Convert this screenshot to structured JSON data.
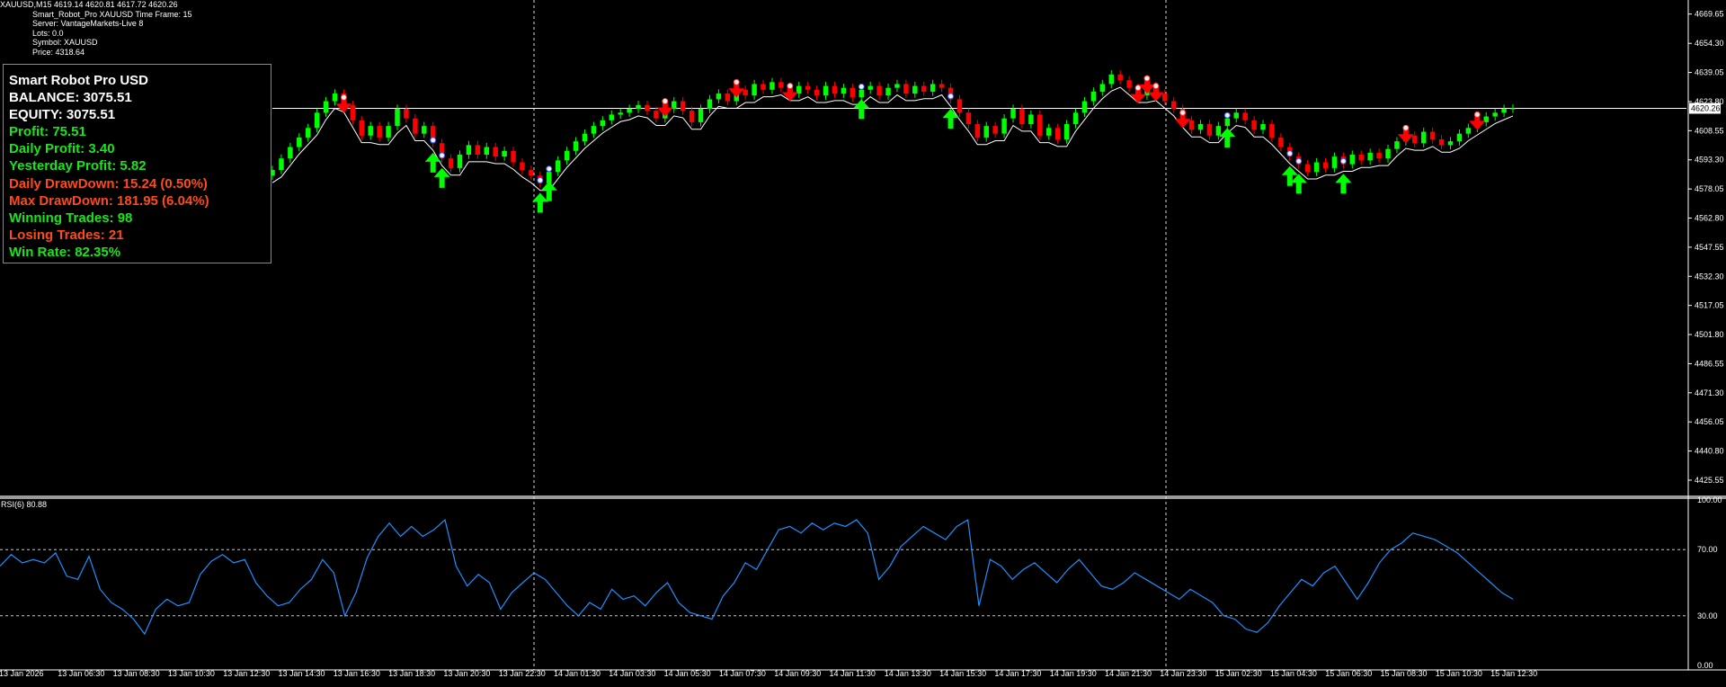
{
  "window": {
    "header_line": "XAUUSD,M15  4619.14 4620.81 4617.72 4620.26",
    "indicator_lines": [
      "Smart_Robot_Pro  XAUUSD   Time Frame: 15",
      "Server: VantageMarkets-Live 8",
      "Lots: 0.0",
      "Symbol: XAUUSD",
      "Price:  4318.64"
    ]
  },
  "panel": {
    "title": "Smart Robot Pro USD",
    "balance": "BALANCE: 3075.51",
    "equity": "EQUITY: 3075.51",
    "profit": "Profit: 75.51",
    "daily_profit": "Daily Profit: 3.40",
    "yesterday_profit": "Yesterday Profit: 5.82",
    "daily_drawdown": "Daily DrawDown: 15.24 (0.50%)",
    "max_drawdown": "Max DrawDown: 181.95 (6.04%)",
    "winning_trades": "Winning Trades: 98",
    "losing_trades": "Losing Trades: 21",
    "win_rate": "Win Rate: 82.35%"
  },
  "rsi": {
    "label": "RSI(6) 80.88"
  },
  "colors": {
    "background": "#000000",
    "bull": "#00ff00",
    "bear": "#ff0000",
    "rsi_line": "#1e90ff",
    "price_line": "#ffffff",
    "price_tag_bg": "#ffffff",
    "arrow_up": "#00ff00",
    "arrow_down": "#ff0000"
  },
  "chart_data": {
    "type": "candlestick",
    "symbol": "XAUUSD",
    "timeframe": "M15",
    "current_price": 4620.26,
    "price_ticks": [
      "4669.65",
      "4654.30",
      "4639.05",
      "4623.80",
      "4608.55",
      "4593.30",
      "4578.05",
      "4562.80",
      "4547.55",
      "4532.30",
      "4517.05",
      "4501.80",
      "4486.55",
      "4471.30",
      "4456.05",
      "4440.80",
      "4425.55"
    ],
    "rsi_ticks": [
      "100.00",
      "70.00",
      "30.00",
      "0.00"
    ],
    "time_labels": [
      "13 Jan 2026",
      "13 Jan 06:30",
      "13 Jan 08:30",
      "13 Jan 10:30",
      "13 Jan 12:30",
      "13 Jan 14:30",
      "13 Jan 16:30",
      "13 Jan 18:30",
      "13 Jan 20:30",
      "13 Jan 22:30",
      "14 Jan 01:30",
      "14 Jan 03:30",
      "14 Jan 05:30",
      "14 Jan 07:30",
      "14 Jan 09:30",
      "14 Jan 11:30",
      "14 Jan 13:30",
      "14 Jan 15:30",
      "14 Jan 17:30",
      "14 Jan 19:30",
      "14 Jan 21:30",
      "14 Jan 23:30",
      "15 Jan 02:30",
      "15 Jan 04:30",
      "15 Jan 06:30",
      "15 Jan 08:30",
      "15 Jan 10:30",
      "15 Jan 12:30"
    ],
    "price_range": [
      4418,
      4677
    ],
    "rsi_range": [
      0,
      100
    ],
    "candles_start_index": 0,
    "closes": [
      4588,
      4594,
      4600,
      4605,
      4610,
      4618,
      4624,
      4628,
      4622,
      4614,
      4606,
      4611,
      4605,
      4611,
      4620,
      4615,
      4607,
      4611,
      4602,
      4594,
      4589,
      4596,
      4601,
      4596,
      4600,
      4595,
      4598,
      4592,
      4588,
      4585,
      4581,
      4587,
      4593,
      4598,
      4603,
      4607,
      4611,
      4614,
      4617,
      4618,
      4620,
      4622,
      4619,
      4615,
      4620,
      4624,
      4619,
      4613,
      4620,
      4625,
      4628,
      4624,
      4630,
      4627,
      4633,
      4630,
      4634,
      4631,
      4628,
      4632,
      4630,
      4627,
      4632,
      4628,
      4631,
      4626,
      4630,
      4632,
      4627,
      4631,
      4633,
      4628,
      4632,
      4629,
      4633,
      4631,
      4625,
      4618,
      4612,
      4605,
      4611,
      4607,
      4615,
      4620,
      4612,
      4617,
      4606,
      4610,
      4604,
      4612,
      4618,
      4624,
      4629,
      4633,
      4638,
      4635,
      4631,
      4627,
      4632,
      4628,
      4624,
      4620,
      4614,
      4609,
      4612,
      4606,
      4611,
      4615,
      4618,
      4614,
      4609,
      4612,
      4605,
      4600,
      4595,
      4591,
      4587,
      4592,
      4589,
      4595,
      4591,
      4596,
      4593,
      4597,
      4594,
      4599,
      4603,
      4606,
      4602,
      4608,
      4604,
      4601,
      4603,
      4607,
      4610,
      4613,
      4616,
      4618,
      4620,
      4620.26
    ],
    "rsi_values": [
      60,
      67,
      62,
      64,
      62,
      68,
      54,
      52,
      66,
      46,
      38,
      34,
      28,
      19,
      34,
      40,
      36,
      38,
      55,
      63,
      67,
      62,
      64,
      50,
      42,
      36,
      38,
      46,
      52,
      64,
      56,
      30,
      44,
      65,
      78,
      86,
      78,
      84,
      78,
      82,
      88,
      60,
      48,
      55,
      50,
      34,
      44,
      50,
      56,
      52,
      44,
      36,
      30,
      38,
      34,
      46,
      40,
      42,
      36,
      44,
      50,
      38,
      32,
      30,
      28,
      42,
      50,
      62,
      58,
      70,
      82,
      84,
      80,
      86,
      82,
      86,
      84,
      88,
      80,
      52,
      60,
      72,
      78,
      84,
      80,
      76,
      84,
      88,
      36,
      64,
      60,
      52,
      58,
      62,
      56,
      50,
      58,
      64,
      56,
      48,
      46,
      50,
      56,
      52,
      48,
      44,
      40,
      46,
      42,
      38,
      30,
      28,
      22,
      20,
      26,
      36,
      44,
      52,
      48,
      56,
      60,
      50,
      40,
      50,
      62,
      70,
      74,
      80,
      78,
      76,
      72,
      68,
      62,
      56,
      50,
      44,
      40
    ],
    "buy_arrows_index": [
      18,
      19,
      30,
      31,
      66,
      76,
      107,
      114,
      115,
      120
    ],
    "sell_arrows_index": [
      8,
      44,
      52,
      58,
      97,
      98,
      99,
      102,
      127,
      135
    ]
  }
}
